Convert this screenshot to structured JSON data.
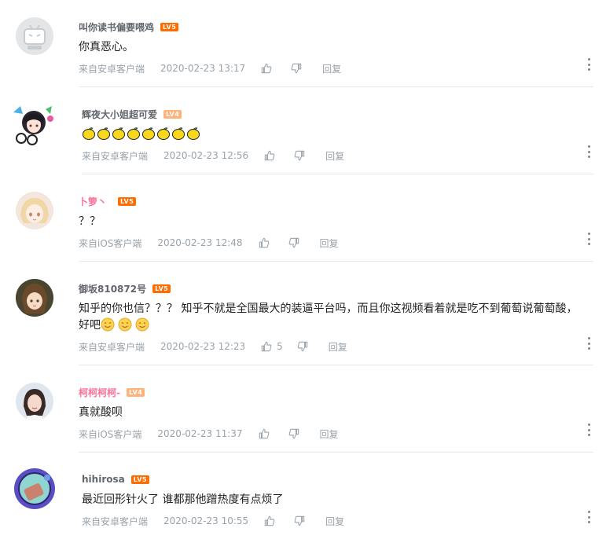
{
  "comments": [
    {
      "username": "叫你读书偏要喂鸡",
      "level": "LV5",
      "name_color": "gray",
      "text": "你真恶心。",
      "emoji_count": 0,
      "source": "来自安卓客户端",
      "time": "2020-02-23 13:17",
      "likes": "",
      "reply": "回复",
      "avatar": "default-tv-avatar"
    },
    {
      "username": "辉夜大小姐超可爱",
      "level": "LV4",
      "name_color": "gray",
      "text": "",
      "emoji_count": 8,
      "emoji": "lemon",
      "source": "来自安卓客户端",
      "time": "2020-02-23 12:56",
      "likes": "",
      "reply": "回复",
      "avatar": "anime-girl-avatar"
    },
    {
      "username": "卜箩丶",
      "level": "LV5",
      "name_color": "pink",
      "text": "？？",
      "emoji_count": 0,
      "source": "来自iOS客户端",
      "time": "2020-02-23 12:48",
      "likes": "",
      "reply": "回复",
      "avatar": "blonde-girl-avatar"
    },
    {
      "username": "御坂810872号",
      "level": "LV5",
      "name_color": "gray",
      "text": "知乎的你也信？？？ 知乎不就是全国最大的装逼平台吗，而且你这视频看着就是吃不到葡萄说葡萄酸，好吧",
      "emoji_count": 3,
      "emoji": "smile",
      "source": "来自安卓客户端",
      "time": "2020-02-23 12:23",
      "likes": "5",
      "reply": "回复",
      "avatar": "brown-hair-avatar"
    },
    {
      "username": "柯柯柯柯-",
      "level": "LV4",
      "name_color": "pink",
      "text": "真就酸呗",
      "emoji_count": 0,
      "source": "来自iOS客户端",
      "time": "2020-02-23 11:37",
      "likes": "",
      "reply": "回复",
      "avatar": "photo-girl-avatar"
    },
    {
      "username": "hihirosa",
      "level": "LV5",
      "name_color": "gray",
      "text": "最近回形针火了 谁都那他蹭热度有点烦了",
      "emoji_count": 0,
      "source": "来自安卓客户端",
      "time": "2020-02-23 10:55",
      "likes": "",
      "reply": "回复",
      "avatar": "globe-avatar"
    }
  ],
  "colors": {
    "username_gray": "#61666d",
    "username_pink": "#fb7299",
    "meta_text": "#99a2aa",
    "level_orange": "#ff6c00",
    "divider": "#e5e9ef"
  }
}
